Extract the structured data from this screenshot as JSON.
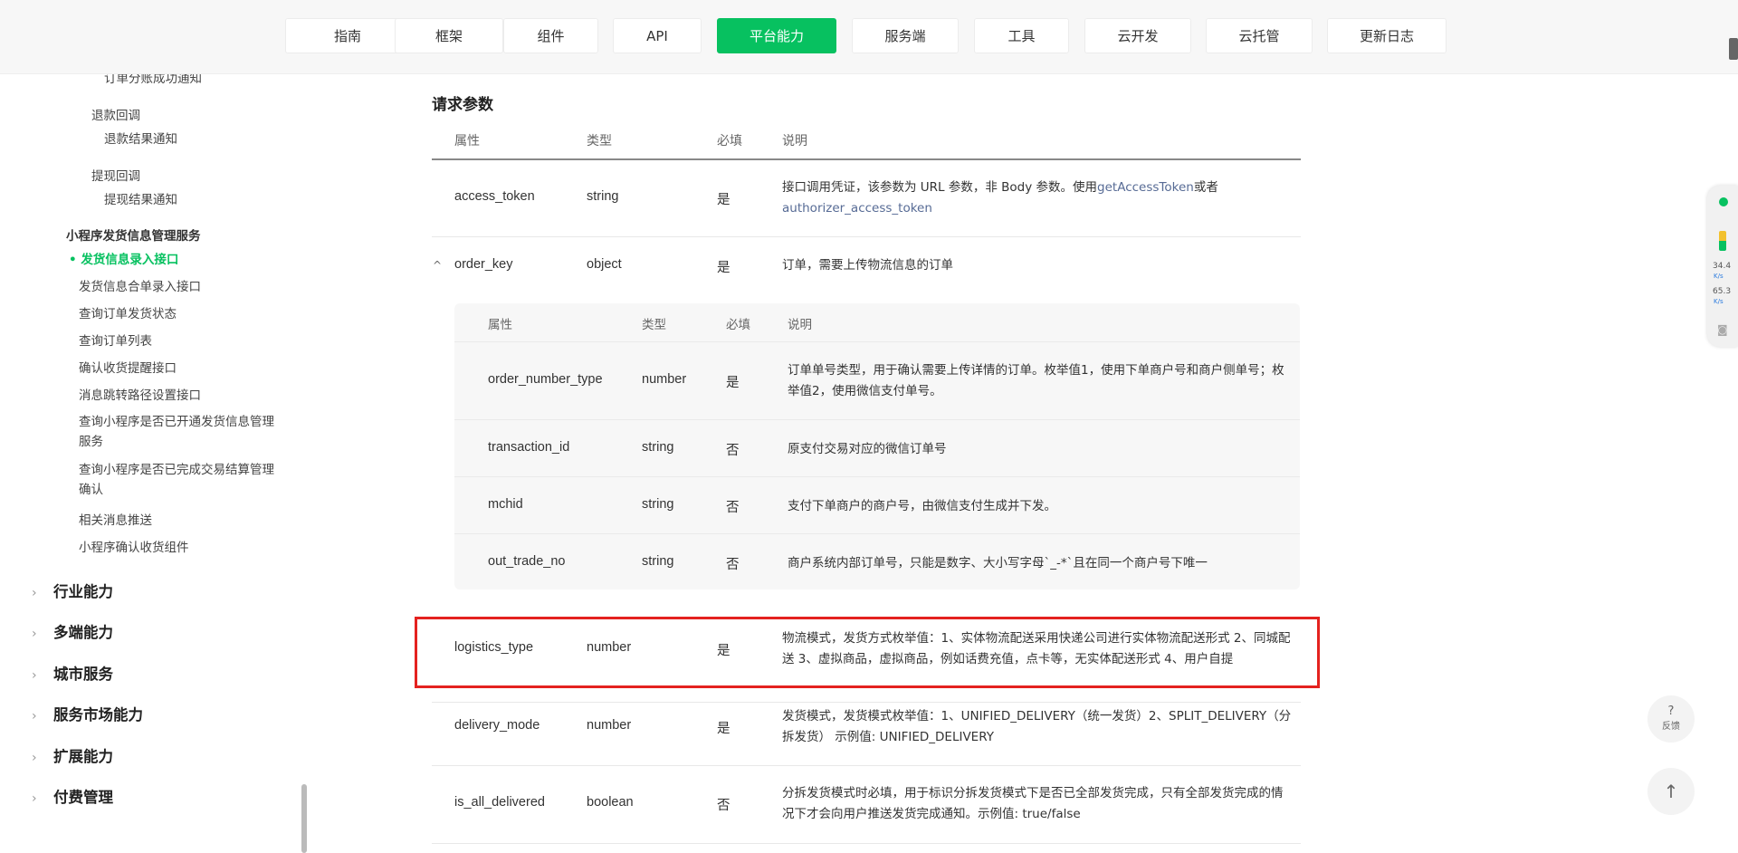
{
  "nav": {
    "items": [
      {
        "label": "指南",
        "active": false
      },
      {
        "label": "框架",
        "active": false
      },
      {
        "label": "组件",
        "active": false
      },
      {
        "label": "API",
        "active": false
      },
      {
        "label": "平台能力",
        "active": true
      },
      {
        "label": "服务端",
        "active": false
      },
      {
        "label": "工具",
        "active": false
      },
      {
        "label": "云开发",
        "active": false
      },
      {
        "label": "云托管",
        "active": false
      },
      {
        "label": "更新日志",
        "active": false
      }
    ]
  },
  "sidebar": {
    "items": [
      {
        "label": "订单分账成功通知"
      },
      {
        "label": "退款回调"
      },
      {
        "label": "退款结果通知"
      },
      {
        "label": "提现回调"
      },
      {
        "label": "提现结果通知"
      },
      {
        "label": "小程序发货信息管理服务"
      },
      {
        "label": "发货信息录入接口"
      },
      {
        "label": "发货信息合单录入接口"
      },
      {
        "label": "查询订单发货状态"
      },
      {
        "label": "查询订单列表"
      },
      {
        "label": "确认收货提醒接口"
      },
      {
        "label": "消息跳转路径设置接口"
      },
      {
        "label": "查询小程序是否已开通发货信息管理服务"
      },
      {
        "label": "查询小程序是否已完成交易结算管理确认"
      },
      {
        "label": "相关消息推送"
      },
      {
        "label": "小程序确认收货组件"
      }
    ],
    "categories": [
      {
        "label": "行业能力"
      },
      {
        "label": "多端能力"
      },
      {
        "label": "城市服务"
      },
      {
        "label": "服务市场能力"
      },
      {
        "label": "扩展能力"
      },
      {
        "label": "付费管理"
      }
    ]
  },
  "section": {
    "title": "请求参数",
    "headers": [
      "属性",
      "类型",
      "必填",
      "说明"
    ]
  },
  "params": {
    "access_token": {
      "name": "access_token",
      "type": "string",
      "required": "是",
      "desc_prefix": "接口调用凭证，该参数为 URL 参数，非 Body 参数。使用",
      "link1": "getAccessToken",
      "desc_mid": "或者",
      "link2": "authorizer_access_token"
    },
    "order_key": {
      "name": "order_key",
      "type": "object",
      "required": "是",
      "desc": "订单，需要上传物流信息的订单"
    },
    "logistics_type": {
      "name": "logistics_type",
      "type": "number",
      "required": "是",
      "desc": "物流模式，发货方式枚举值：1、实体物流配送采用快递公司进行实体物流配送形式 2、同城配送 3、虚拟商品，虚拟商品，例如话费充值，点卡等，无实体配送形式 4、用户自提"
    },
    "delivery_mode": {
      "name": "delivery_mode",
      "type": "number",
      "required": "是",
      "desc": "发货模式，发货模式枚举值：1、UNIFIED_DELIVERY（统一发货）2、SPLIT_DELIVERY（分拆发货） 示例值: UNIFIED_DELIVERY"
    },
    "is_all_delivered": {
      "name": "is_all_delivered",
      "type": "boolean",
      "required": "否",
      "desc": "分拆发货模式时必填，用于标识分拆发货模式下是否已全部发货完成，只有全部发货完成的情况下才会向用户推送发货完成通知。示例值: true/false"
    }
  },
  "nested": {
    "headers": [
      "属性",
      "类型",
      "必填",
      "说明"
    ],
    "rows": [
      {
        "name": "order_number_type",
        "type": "number",
        "required": "是",
        "desc": "订单单号类型，用于确认需要上传详情的订单。枚举值1，使用下单商户号和商户侧单号；枚举值2，使用微信支付单号。"
      },
      {
        "name": "transaction_id",
        "type": "string",
        "required": "否",
        "desc": "原支付交易对应的微信订单号"
      },
      {
        "name": "mchid",
        "type": "string",
        "required": "否",
        "desc": "支付下单商户的商户号，由微信支付生成并下发。"
      },
      {
        "name": "out_trade_no",
        "type": "string",
        "required": "否",
        "desc": "商户系统内部订单号，只能是数字、大小写字母`_-*`且在同一个商户号下唯一"
      }
    ]
  },
  "perf": {
    "val1": "34.4",
    "unit1": "K/s",
    "val2": "65.3",
    "unit2": "K/s"
  },
  "tools": {
    "feedback_icon": "?",
    "feedback_label": "反馈",
    "top_icon": "↑"
  }
}
